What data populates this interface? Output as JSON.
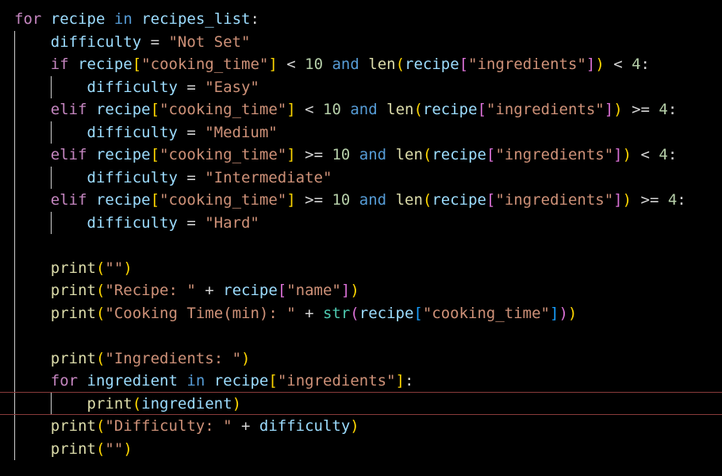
{
  "editor": {
    "accent_colors": {
      "keyword_control": "#c586c0",
      "keyword": "#569cd6",
      "variable": "#9cdcfe",
      "function": "#dcdcaa",
      "string": "#ce9178",
      "number": "#b5cea8",
      "bracket_level_1": "#ffd700",
      "bracket_level_2": "#da70d6",
      "bracket_level_3": "#179fff",
      "current_line_border": "#8a3b3b"
    },
    "current_line": 18,
    "lines": [
      {
        "tokens": [
          {
            "t": "for",
            "c": "kw"
          },
          {
            "t": " "
          },
          {
            "t": "recipe",
            "c": "var"
          },
          {
            "t": " "
          },
          {
            "t": "in",
            "c": "ks"
          },
          {
            "t": " "
          },
          {
            "t": "recipes_list",
            "c": "var"
          },
          {
            "t": ":"
          }
        ]
      },
      {
        "tokens": [
          {
            "t": "    "
          },
          {
            "t": "difficulty",
            "c": "var"
          },
          {
            "t": " = "
          },
          {
            "t": "\"Not Set\"",
            "c": "str"
          }
        ]
      },
      {
        "tokens": [
          {
            "t": "    "
          },
          {
            "t": "if",
            "c": "kw"
          },
          {
            "t": " "
          },
          {
            "t": "recipe",
            "c": "var"
          },
          {
            "t": "[",
            "c": "br1"
          },
          {
            "t": "\"cooking_time\"",
            "c": "str"
          },
          {
            "t": "]",
            "c": "br1"
          },
          {
            "t": " < "
          },
          {
            "t": "10",
            "c": "num"
          },
          {
            "t": " "
          },
          {
            "t": "and",
            "c": "ks"
          },
          {
            "t": " "
          },
          {
            "t": "len",
            "c": "fn"
          },
          {
            "t": "(",
            "c": "br1"
          },
          {
            "t": "recipe",
            "c": "var"
          },
          {
            "t": "[",
            "c": "br2"
          },
          {
            "t": "\"ingredients\"",
            "c": "str"
          },
          {
            "t": "]",
            "c": "br2"
          },
          {
            "t": ")",
            "c": "br1"
          },
          {
            "t": " < "
          },
          {
            "t": "4",
            "c": "num"
          },
          {
            "t": ":"
          }
        ]
      },
      {
        "tokens": [
          {
            "t": "        "
          },
          {
            "t": "difficulty",
            "c": "var"
          },
          {
            "t": " = "
          },
          {
            "t": "\"Easy\"",
            "c": "str"
          }
        ]
      },
      {
        "tokens": [
          {
            "t": "    "
          },
          {
            "t": "elif",
            "c": "kw"
          },
          {
            "t": " "
          },
          {
            "t": "recipe",
            "c": "var"
          },
          {
            "t": "[",
            "c": "br1"
          },
          {
            "t": "\"cooking_time\"",
            "c": "str"
          },
          {
            "t": "]",
            "c": "br1"
          },
          {
            "t": " < "
          },
          {
            "t": "10",
            "c": "num"
          },
          {
            "t": " "
          },
          {
            "t": "and",
            "c": "ks"
          },
          {
            "t": " "
          },
          {
            "t": "len",
            "c": "fn"
          },
          {
            "t": "(",
            "c": "br1"
          },
          {
            "t": "recipe",
            "c": "var"
          },
          {
            "t": "[",
            "c": "br2"
          },
          {
            "t": "\"ingredients\"",
            "c": "str"
          },
          {
            "t": "]",
            "c": "br2"
          },
          {
            "t": ")",
            "c": "br1"
          },
          {
            "t": " >= "
          },
          {
            "t": "4",
            "c": "num"
          },
          {
            "t": ":"
          }
        ]
      },
      {
        "tokens": [
          {
            "t": "        "
          },
          {
            "t": "difficulty",
            "c": "var"
          },
          {
            "t": " = "
          },
          {
            "t": "\"Medium\"",
            "c": "str"
          }
        ]
      },
      {
        "tokens": [
          {
            "t": "    "
          },
          {
            "t": "elif",
            "c": "kw"
          },
          {
            "t": " "
          },
          {
            "t": "recipe",
            "c": "var"
          },
          {
            "t": "[",
            "c": "br1"
          },
          {
            "t": "\"cooking_time\"",
            "c": "str"
          },
          {
            "t": "]",
            "c": "br1"
          },
          {
            "t": " >= "
          },
          {
            "t": "10",
            "c": "num"
          },
          {
            "t": " "
          },
          {
            "t": "and",
            "c": "ks"
          },
          {
            "t": " "
          },
          {
            "t": "len",
            "c": "fn"
          },
          {
            "t": "(",
            "c": "br1"
          },
          {
            "t": "recipe",
            "c": "var"
          },
          {
            "t": "[",
            "c": "br2"
          },
          {
            "t": "\"ingredients\"",
            "c": "str"
          },
          {
            "t": "]",
            "c": "br2"
          },
          {
            "t": ")",
            "c": "br1"
          },
          {
            "t": " < "
          },
          {
            "t": "4",
            "c": "num"
          },
          {
            "t": ":"
          }
        ]
      },
      {
        "tokens": [
          {
            "t": "        "
          },
          {
            "t": "difficulty",
            "c": "var"
          },
          {
            "t": " = "
          },
          {
            "t": "\"Intermediate\"",
            "c": "str"
          }
        ]
      },
      {
        "tokens": [
          {
            "t": "    "
          },
          {
            "t": "elif",
            "c": "kw"
          },
          {
            "t": " "
          },
          {
            "t": "recipe",
            "c": "var"
          },
          {
            "t": "[",
            "c": "br1"
          },
          {
            "t": "\"cooking_time\"",
            "c": "str"
          },
          {
            "t": "]",
            "c": "br1"
          },
          {
            "t": " >= "
          },
          {
            "t": "10",
            "c": "num"
          },
          {
            "t": " "
          },
          {
            "t": "and",
            "c": "ks"
          },
          {
            "t": " "
          },
          {
            "t": "len",
            "c": "fn"
          },
          {
            "t": "(",
            "c": "br1"
          },
          {
            "t": "recipe",
            "c": "var"
          },
          {
            "t": "[",
            "c": "br2"
          },
          {
            "t": "\"ingredients\"",
            "c": "str"
          },
          {
            "t": "]",
            "c": "br2"
          },
          {
            "t": ")",
            "c": "br1"
          },
          {
            "t": " >= "
          },
          {
            "t": "4",
            "c": "num"
          },
          {
            "t": ":"
          }
        ]
      },
      {
        "tokens": [
          {
            "t": "        "
          },
          {
            "t": "difficulty",
            "c": "var"
          },
          {
            "t": " = "
          },
          {
            "t": "\"Hard\"",
            "c": "str"
          }
        ]
      },
      {
        "tokens": []
      },
      {
        "tokens": [
          {
            "t": "    "
          },
          {
            "t": "print",
            "c": "fn"
          },
          {
            "t": "(",
            "c": "br1"
          },
          {
            "t": "\"\"",
            "c": "str"
          },
          {
            "t": ")",
            "c": "br1"
          }
        ]
      },
      {
        "tokens": [
          {
            "t": "    "
          },
          {
            "t": "print",
            "c": "fn"
          },
          {
            "t": "(",
            "c": "br1"
          },
          {
            "t": "\"Recipe: \"",
            "c": "str"
          },
          {
            "t": " + "
          },
          {
            "t": "recipe",
            "c": "var"
          },
          {
            "t": "[",
            "c": "br2"
          },
          {
            "t": "\"name\"",
            "c": "str"
          },
          {
            "t": "]",
            "c": "br2"
          },
          {
            "t": ")",
            "c": "br1"
          }
        ]
      },
      {
        "tokens": [
          {
            "t": "    "
          },
          {
            "t": "print",
            "c": "fn"
          },
          {
            "t": "(",
            "c": "br1"
          },
          {
            "t": "\"Cooking Time(min): \"",
            "c": "str"
          },
          {
            "t": " + "
          },
          {
            "t": "str",
            "c": "bi"
          },
          {
            "t": "(",
            "c": "br2"
          },
          {
            "t": "recipe",
            "c": "var"
          },
          {
            "t": "[",
            "c": "br3"
          },
          {
            "t": "\"cooking_time\"",
            "c": "str"
          },
          {
            "t": "]",
            "c": "br3"
          },
          {
            "t": ")",
            "c": "br2"
          },
          {
            "t": ")",
            "c": "br1"
          }
        ]
      },
      {
        "tokens": []
      },
      {
        "tokens": [
          {
            "t": "    "
          },
          {
            "t": "print",
            "c": "fn"
          },
          {
            "t": "(",
            "c": "br1"
          },
          {
            "t": "\"Ingredients: \"",
            "c": "str"
          },
          {
            "t": ")",
            "c": "br1"
          }
        ]
      },
      {
        "tokens": [
          {
            "t": "    "
          },
          {
            "t": "for",
            "c": "kw"
          },
          {
            "t": " "
          },
          {
            "t": "ingredient",
            "c": "var"
          },
          {
            "t": " "
          },
          {
            "t": "in",
            "c": "ks"
          },
          {
            "t": " "
          },
          {
            "t": "recipe",
            "c": "var"
          },
          {
            "t": "[",
            "c": "br1"
          },
          {
            "t": "\"ingredients\"",
            "c": "str"
          },
          {
            "t": "]",
            "c": "br1"
          },
          {
            "t": ":"
          }
        ]
      },
      {
        "tokens": [
          {
            "t": "        "
          },
          {
            "t": "print",
            "c": "fn"
          },
          {
            "t": "(",
            "c": "br1"
          },
          {
            "t": "ingredient",
            "c": "var"
          },
          {
            "t": ")",
            "c": "br1"
          }
        ]
      },
      {
        "tokens": [
          {
            "t": "    "
          },
          {
            "t": "print",
            "c": "fn"
          },
          {
            "t": "(",
            "c": "br1"
          },
          {
            "t": "\"Difficulty: \"",
            "c": "str"
          },
          {
            "t": " + "
          },
          {
            "t": "difficulty",
            "c": "var"
          },
          {
            "t": ")",
            "c": "br1"
          }
        ]
      },
      {
        "tokens": [
          {
            "t": "    "
          },
          {
            "t": "print",
            "c": "fn"
          },
          {
            "t": "(",
            "c": "br1"
          },
          {
            "t": "\"\"",
            "c": "str"
          },
          {
            "t": ")",
            "c": "br1"
          }
        ]
      }
    ]
  }
}
